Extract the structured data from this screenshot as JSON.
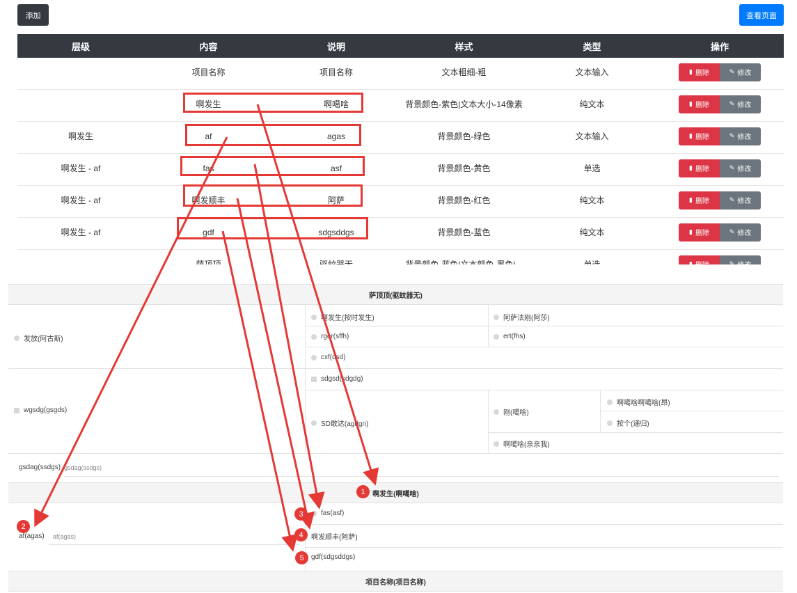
{
  "toolbar": {
    "add_label": "添加",
    "view_label": "查看页面"
  },
  "table": {
    "headers": [
      "层级",
      "内容",
      "说明",
      "样式",
      "类型",
      "操作"
    ],
    "delete_label": "删除",
    "edit_label": "修改",
    "rows": [
      {
        "level": "",
        "content": "项目名称",
        "desc": "项目名称",
        "style": "文本粗细-粗",
        "type": "文本输入"
      },
      {
        "level": "",
        "content": "啊发生",
        "desc": "啊噶啥",
        "style": "背景颜色-紫色|文本大小-14像素",
        "type": "纯文本"
      },
      {
        "level": "啊发生",
        "content": "af",
        "desc": "agas",
        "style": "背景颜色-绿色",
        "type": "文本输入"
      },
      {
        "level": "啊发生 - af",
        "content": "fas",
        "desc": "asf",
        "style": "背景颜色-黄色",
        "type": "单选"
      },
      {
        "level": "啊发生 - af",
        "content": "啊发顺丰",
        "desc": "阿萨",
        "style": "背景颜色-红色",
        "type": "纯文本"
      },
      {
        "level": "啊发生 - af",
        "content": "gdf",
        "desc": "sdgsddgs",
        "style": "背景颜色-蓝色",
        "type": "纯文本"
      },
      {
        "level": "",
        "content": "萨顶顶",
        "desc": "驱蚊器无",
        "style": "背景颜色-蓝色|文本颜色-黑色|...",
        "type": "单选"
      }
    ]
  },
  "preview": {
    "section1_title": "萨顶顶(驱蚊器无)",
    "fafang": "发放(阿古斯)",
    "opt_afasheng": "啊发生(按时发生)",
    "opt_asa": "阿萨法刚(阿莎)",
    "opt_rger": "rger(sffh)",
    "opt_ert": "ert(fhs)",
    "opt_cxf": "cxf(dsd)",
    "opt_sdgsd": "sdgsd(sdgdg)",
    "wgsdg": "wgsdg(gsgds)",
    "opt_sd": "SD敢达(agdgn)",
    "opt_gang": "刚(噶啥)",
    "opt_aga1": "啊噶啥啊噶啥(昂)",
    "opt_angge": "按个(递归)",
    "opt_aga2": "啊噶啥(亲亲我)",
    "gsdag_label": "gsdag(ssdgs)",
    "gsdag_placeholder": "gsdag(ssdgs)",
    "section2_title": "啊发生(啊噶啥)",
    "af_label": "af(agas)",
    "af_placeholder": "af(agas)",
    "opt_fas": "fas(asf)",
    "shunfeng": "啊发顺丰(阿萨)",
    "gdf": "gdf(sdgsddgs)",
    "section3_title": "项目名称(项目名称)"
  },
  "markers": [
    "1",
    "2",
    "3",
    "4",
    "5"
  ],
  "colors": {
    "dark": "#343a40",
    "blue": "#007bff",
    "red": "#dc3545",
    "gray": "#6c757d",
    "annotation": "#e53935"
  }
}
